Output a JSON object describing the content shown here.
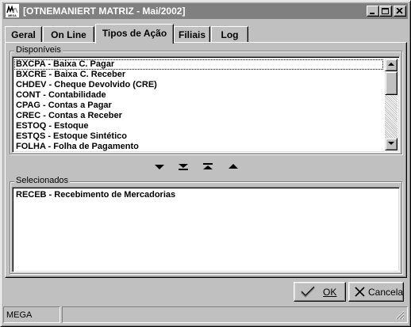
{
  "window": {
    "title": "[OTNEMANIERT MATRIZ - Mai/2002]",
    "icon_text": "MEGA"
  },
  "titlebar_buttons": {
    "minimize": "minimize-icon",
    "maximize": "maximize-icon",
    "close": "close-icon"
  },
  "tabs": [
    {
      "label": "Geral",
      "active": false
    },
    {
      "label": "On Line",
      "active": false
    },
    {
      "label": "Tipos de Ação",
      "active": true
    },
    {
      "label": "Filiais",
      "active": false
    },
    {
      "label": "Log",
      "active": false
    }
  ],
  "available": {
    "label": "Disponíveis",
    "items": [
      "BXCPA - Baixa C. Pagar",
      "BXCRE - Baixa C. Receber",
      "CHDEV - Cheque Devolvido (CRE)",
      "CONT - Contabilidade",
      "CPAG - Contas a Pagar",
      "CREC - Contas a Receber",
      "ESTOQ - Estoque",
      "ESTQS - Estoque Sintético",
      "FOLHA - Folha de Pagamento"
    ]
  },
  "move_buttons": {
    "add": "arrow-down-icon",
    "add_all": "arrow-down-all-icon",
    "remove_all": "arrow-up-all-icon",
    "remove": "arrow-up-icon"
  },
  "selected": {
    "label": "Selecionados",
    "items": [
      "RECEB - Recebimento de Mercadorias"
    ]
  },
  "buttons": {
    "ok_label": "OK",
    "cancel_label": "Cancela"
  },
  "statusbar": {
    "panel1": "MEGA",
    "panel2": ""
  }
}
